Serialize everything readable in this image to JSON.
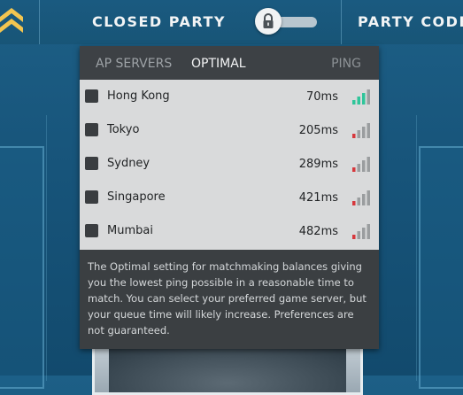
{
  "topbar": {
    "closed_party_label": "CLOSED PARTY",
    "party_code_label": "PARTY CODE",
    "toggle_state": "off"
  },
  "server_panel": {
    "tabs": {
      "ap_servers": "AP SERVERS",
      "optimal": "OPTIMAL",
      "ping": "PING"
    },
    "servers": [
      {
        "name": "Hong Kong",
        "ping": "70ms",
        "bars_filled": 3,
        "level": "good"
      },
      {
        "name": "Tokyo",
        "ping": "205ms",
        "bars_filled": 1,
        "level": "bad"
      },
      {
        "name": "Sydney",
        "ping": "289ms",
        "bars_filled": 1,
        "level": "bad"
      },
      {
        "name": "Singapore",
        "ping": "421ms",
        "bars_filled": 1,
        "level": "bad"
      },
      {
        "name": "Mumbai",
        "ping": "482ms",
        "bars_filled": 1,
        "level": "bad"
      }
    ],
    "info": "The Optimal setting for matchmaking balances giving you the lowest ping possible in a reasonable time to match. You can select your preferred game server, but your queue time will likely increase. Preferences are not guaranteed."
  },
  "colors": {
    "signal_good": "#2fc59a",
    "signal_bad": "#d6383d",
    "signal_empty": "#9a9d9f",
    "accent_chevron": "#f3c550"
  }
}
